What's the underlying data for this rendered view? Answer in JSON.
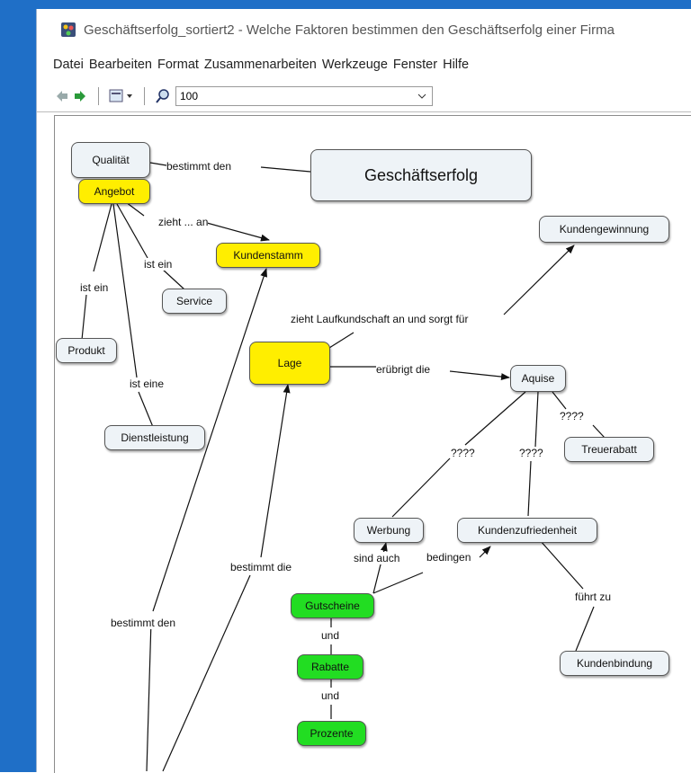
{
  "window": {
    "title": "Geschäftserfolg_sortiert2 - Welche Faktoren bestimmen den Geschäftserfolg einer Firma"
  },
  "menu": [
    "Datei",
    "Bearbeiten",
    "Format",
    "Zusammenarbeiten",
    "Werkzeuge",
    "Fenster",
    "Hilfe"
  ],
  "toolbar": {
    "zoom_value": "100"
  },
  "nodes": {
    "qualitaet": "Qualität",
    "angebot": "Angebot",
    "geschaeftserfolg": "Geschäftserfolg",
    "kundenstamm": "Kundenstamm",
    "kundengewinnung": "Kundengewinnung",
    "service": "Service",
    "produkt": "Produkt",
    "lage": "Lage",
    "aquise": "Aquise",
    "dienstleistung": "Dienstleistung",
    "treuerabatt": "Treuerabatt",
    "werbung": "Werbung",
    "kundenzufriedenheit": "Kundenzufriedenheit",
    "gutscheine": "Gutscheine",
    "rabatte": "Rabatte",
    "prozente": "Prozente",
    "kundenbindung": "Kundenbindung"
  },
  "links": {
    "bestimmt_den_1": "bestimmt den",
    "zieht_an": "zieht ... an",
    "ist_ein_1": "ist ein",
    "ist_ein_2": "ist ein",
    "ist_eine": "ist eine",
    "zieht_laufkundschaft": "zieht Laufkundschaft an und sorgt für",
    "eruebrigt_die": "erübrigt die",
    "q1": "????",
    "q2": "????",
    "q3": "????",
    "bestimmt_die": "bestimmt die",
    "sind_auch": "sind auch",
    "bedingen": "bedingen",
    "fuehrt_zu": "führt zu",
    "bestimmt_den_2": "bestimmt den",
    "und_1": "und",
    "und_2": "und"
  },
  "colors": {
    "concept": "#eef3f7",
    "highlight_yellow": "#ffee00",
    "highlight_green": "#22dd22",
    "frame_blue": "#1f6fc7"
  }
}
